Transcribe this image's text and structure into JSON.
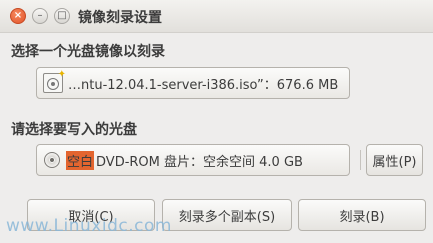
{
  "window": {
    "title": "镜像刻录设置",
    "controls": {
      "close": "×",
      "minimize": "–",
      "maximize": "□"
    }
  },
  "source": {
    "label": "选择一个光盘镜像以刻录",
    "file_text": "…ntu-12.04.1-server-i386.iso”：676.6 MB",
    "icon": "iso-file-icon"
  },
  "target": {
    "label": "请选择要写入的光盘",
    "highlight_text": "空白",
    "disc_text": "DVD-ROM 盘片：空余空间 4.0 GB",
    "icon": "disc-icon",
    "properties_label": "属性(P)"
  },
  "buttons": {
    "cancel": "取消(C)",
    "multi_copy": "刻录多个副本(S)",
    "burn": "刻录(B)"
  },
  "watermark": "www.Linuxidc.com",
  "colors": {
    "highlight": "#e3652f",
    "close_button": "#e2542a",
    "background": "#eeedec"
  }
}
